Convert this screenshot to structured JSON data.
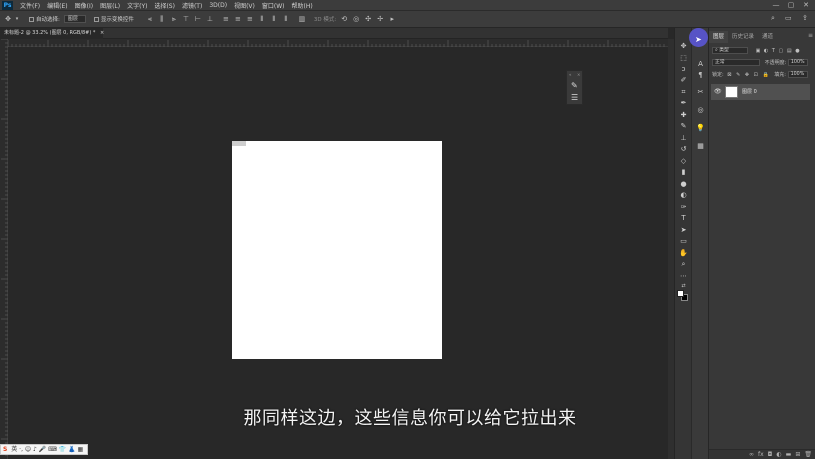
{
  "app": {
    "logo": "Ps"
  },
  "menu": {
    "items": [
      "文件(F)",
      "编辑(E)",
      "图像(I)",
      "图层(L)",
      "文字(Y)",
      "选择(S)",
      "滤镜(T)",
      "3D(D)",
      "视图(V)",
      "窗口(W)",
      "帮助(H)"
    ]
  },
  "window_controls": {
    "minimize": "—",
    "restore": "▢",
    "close": "✕"
  },
  "options_bar": {
    "auto_select_label": "自动选择:",
    "auto_select_value": "图层",
    "show_transform_label": "显示变换控件",
    "mode_3d_label": "3D 模式:"
  },
  "document": {
    "tab_label": "未标题-2 @ 33.2% (图层 0, RGB/8#) *",
    "tab_close": "×"
  },
  "panel": {
    "tabs": [
      "图层",
      "历史记录",
      "通道"
    ],
    "filter_label": "类型",
    "blend_mode": "正常",
    "opacity_label": "不透明度:",
    "opacity_value": "100%",
    "lock_label": "锁定:",
    "fill_label": "填充:",
    "fill_value": "100%",
    "layer_name": "图层 0"
  },
  "subtitle": "那同样这边，这些信息你可以给它拉出来",
  "ime": {
    "brand": "S",
    "text": "英 ·, ☺ ♪ 🎤 ⌨ 👕 👗 ▦"
  },
  "colors": {
    "accent": "#31a8ff",
    "highlight": "#5b57d6",
    "canvas_bg": "#282828",
    "panel_bg": "#383838"
  }
}
